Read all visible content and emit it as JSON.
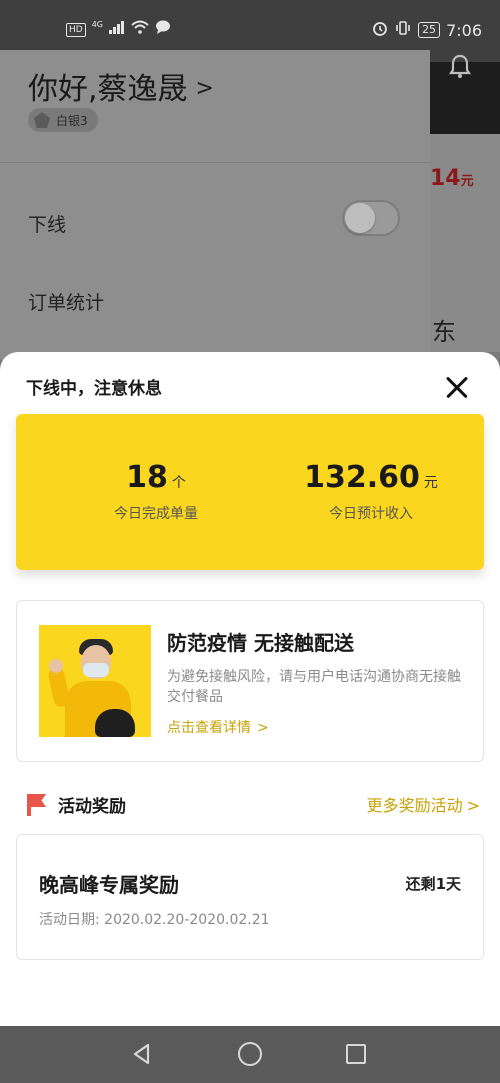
{
  "status_bar": {
    "network_badge": "HD",
    "network_type": "4G",
    "battery": "25",
    "time": "7:06"
  },
  "background": {
    "partial_amount_value": "14",
    "partial_amount_unit": "元",
    "partial_char": "东"
  },
  "drawer": {
    "greeting": "你好,蔡逸晟",
    "level_badge": "白银3",
    "items": [
      {
        "label": "下线",
        "toggle_on": false
      },
      {
        "label": "订单统计"
      }
    ]
  },
  "sheet": {
    "title": "下线中，注意休息",
    "stats": {
      "orders_value": "18",
      "orders_unit": "个",
      "orders_label": "今日完成单量",
      "income_value": "132.60",
      "income_unit": "元",
      "income_label": "今日预计收入"
    },
    "notice": {
      "title": "防范疫情 无接触配送",
      "description": "为避免接触风险，请与用户电话沟通协商无接触交付餐品",
      "link": "点击查看详情"
    },
    "activities": {
      "title": "活动奖励",
      "more": "更多奖励活动",
      "card": {
        "title": "晚高峰专属奖励",
        "remaining": "还剩1天",
        "date": "活动日期: 2020.02.20-2020.02.21"
      }
    }
  },
  "colors": {
    "accent_yellow": "#fbd61f",
    "link_gold": "#c9a106",
    "flag_red": "#e8564a"
  },
  "icons": {
    "bell": "bell-icon",
    "close": "close-icon",
    "flag": "flag-icon",
    "nav_back": "back-triangle-icon",
    "nav_home": "home-circle-icon",
    "nav_recents": "recents-square-icon"
  }
}
